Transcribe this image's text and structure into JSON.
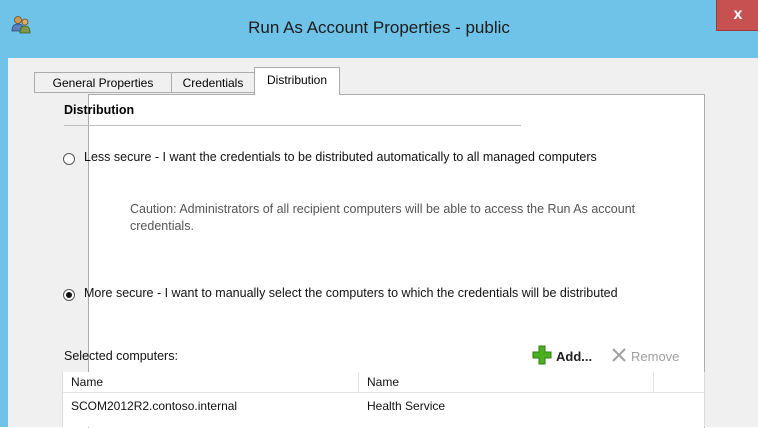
{
  "window": {
    "title": "Run As Account Properties - public",
    "close_glyph": "x",
    "icon": "users-icon"
  },
  "tabs": [
    {
      "label": "General Properties",
      "selected": false
    },
    {
      "label": "Credentials",
      "selected": false
    },
    {
      "label": "Distribution",
      "selected": true
    }
  ],
  "distribution": {
    "section_title": "Distribution",
    "less_secure": {
      "label": "Less secure - I want the credentials to be distributed automatically to all managed computers",
      "checked": false,
      "caution": "Caution: Administrators of all recipient computers will be able to access the Run As account credentials."
    },
    "more_secure": {
      "label": "More secure - I want to manually select the computers to which the credentials will be distributed",
      "checked": true
    },
    "selected_label": "Selected computers:",
    "add_label": "Add...",
    "remove_label": "Remove",
    "columns": [
      "Name",
      "Name"
    ],
    "rows": [
      {
        "name": "SCOM2012R2.contoso.internal",
        "type": "Health Service"
      }
    ]
  },
  "colors": {
    "title_bar": "#6fc3e8",
    "close_button": "#c75050",
    "add_icon": "#4caf1f",
    "remove_icon_disabled": "#a0a0a0"
  }
}
